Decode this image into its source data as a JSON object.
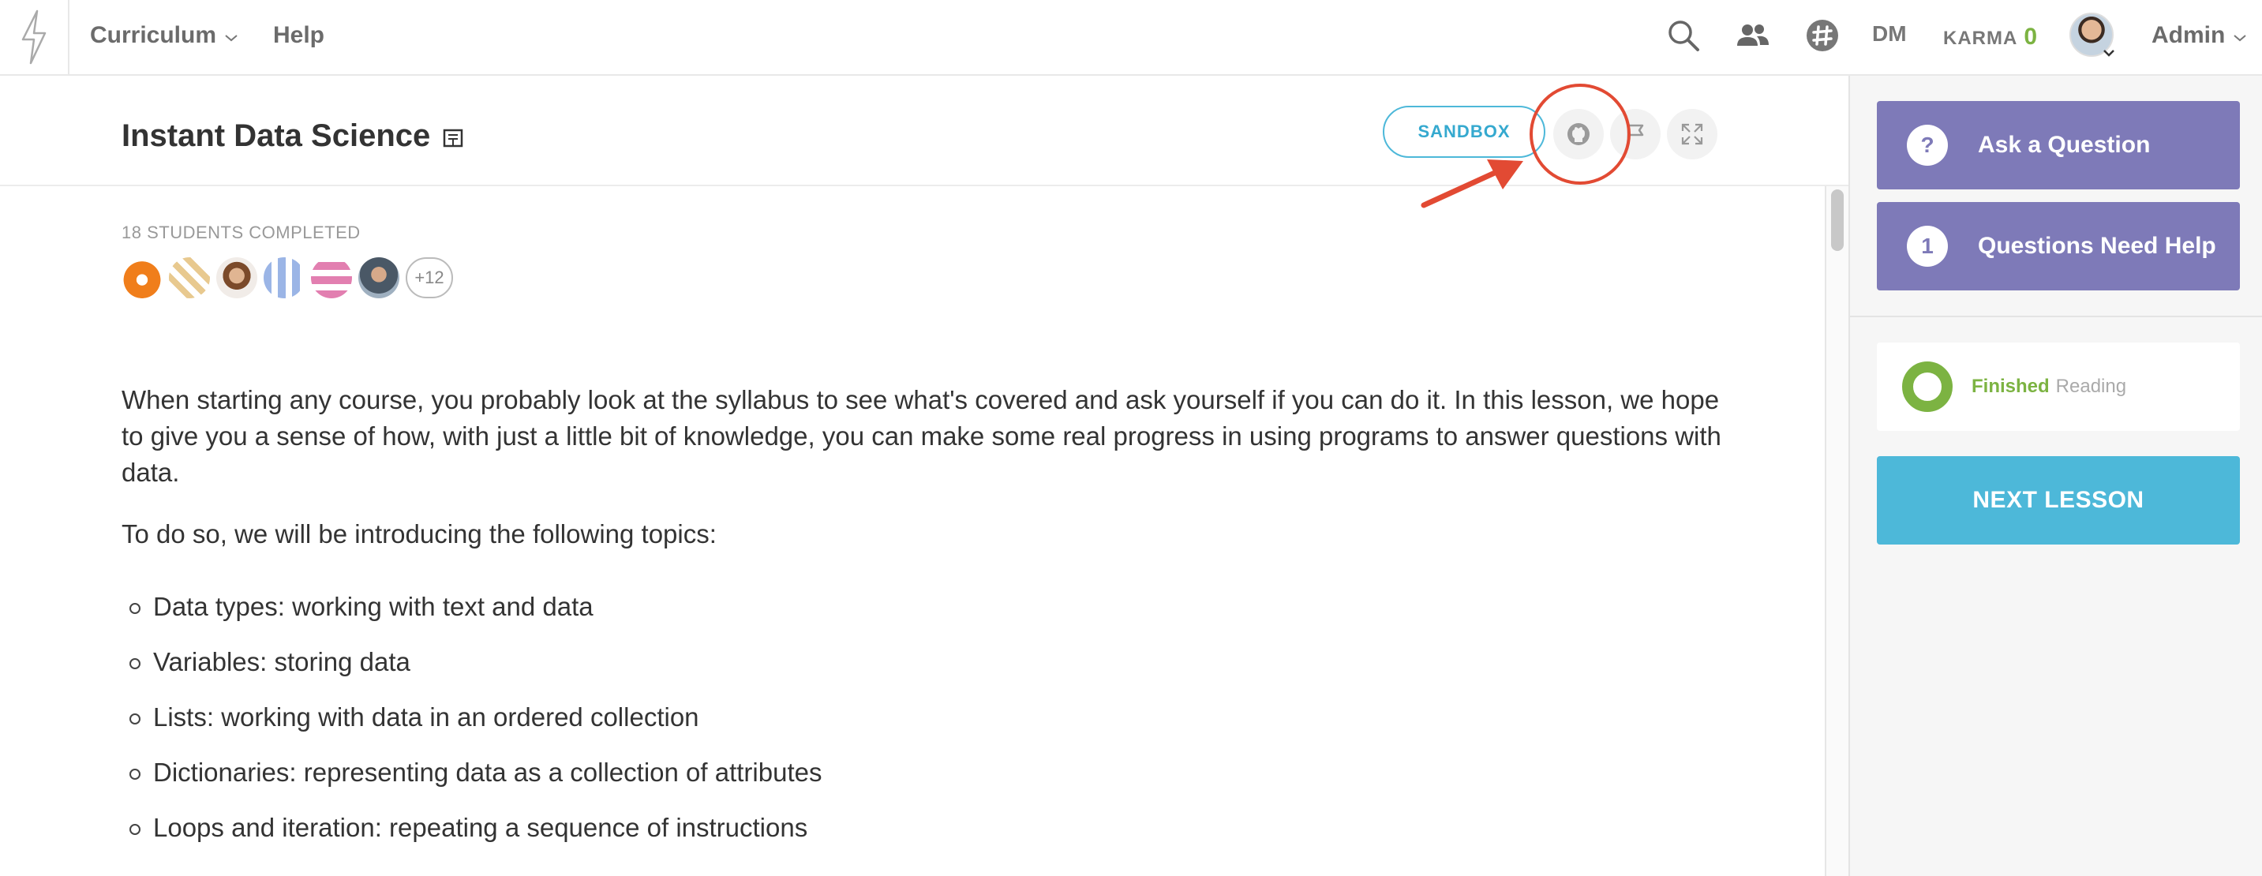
{
  "nav": {
    "curriculum": "Curriculum",
    "help": "Help",
    "dm": "DM",
    "karma_label": "KARMA",
    "karma_value": "0",
    "admin": "Admin"
  },
  "lesson": {
    "title": "Instant Data Science",
    "sandbox": "SANDBOX",
    "completed_label": "18 STUDENTS COMPLETED",
    "more_students": "+12",
    "intro": "When starting any course, you probably look at the syllabus to see what's covered and ask yourself if you can do it. In this lesson, we hope to give you a sense of how, with just a little bit of knowledge, you can make some real progress in using programs to answer questions with data.",
    "topics_intro": "To do so, we will be introducing the following topics:",
    "topics": [
      "Data types: working with text and data",
      "Variables: storing data",
      "Lists: working with data in an ordered collection",
      "Dictionaries: representing data as a collection of attributes",
      "Loops and iteration: repeating a sequence of instructions"
    ]
  },
  "sidebar": {
    "ask_question": "Ask a Question",
    "ask_badge": "?",
    "need_help": "Questions Need Help",
    "need_help_count": "1",
    "finished": "Finished",
    "reading": "Reading",
    "next_lesson": "NEXT LESSON"
  },
  "colors": {
    "accent_blue": "#4db8d9",
    "purple": "#7e7ab8",
    "green": "#7cb342",
    "annotation_red": "#e24a33"
  }
}
